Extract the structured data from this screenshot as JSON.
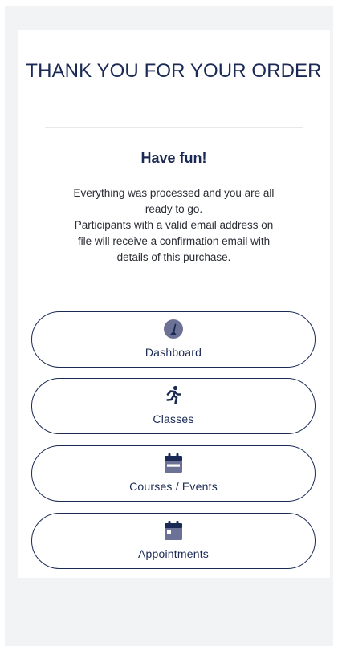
{
  "confirmation": {
    "title": "THANK YOU FOR YOUR ORDER",
    "subtitle": "Have fun!",
    "message_lines": [
      "Everything was processed and you are all",
      "ready to go.",
      "Participants with a valid email address on",
      "file will receive a confirmation email with",
      "details of this purchase."
    ]
  },
  "nav": {
    "dashboard": {
      "label": "Dashboard",
      "icon": "gauge-icon"
    },
    "classes": {
      "label": "Classes",
      "icon": "running-person-icon"
    },
    "courses": {
      "label": "Courses / Events",
      "icon": "calendar-icon"
    },
    "appointments": {
      "label": "Appointments",
      "icon": "calendar-day-icon"
    }
  },
  "colors": {
    "primary": "#1b2a55",
    "icon": "#6b7295",
    "background": "#f2f3f5",
    "card": "#ffffff",
    "text": "#2a2d34"
  }
}
